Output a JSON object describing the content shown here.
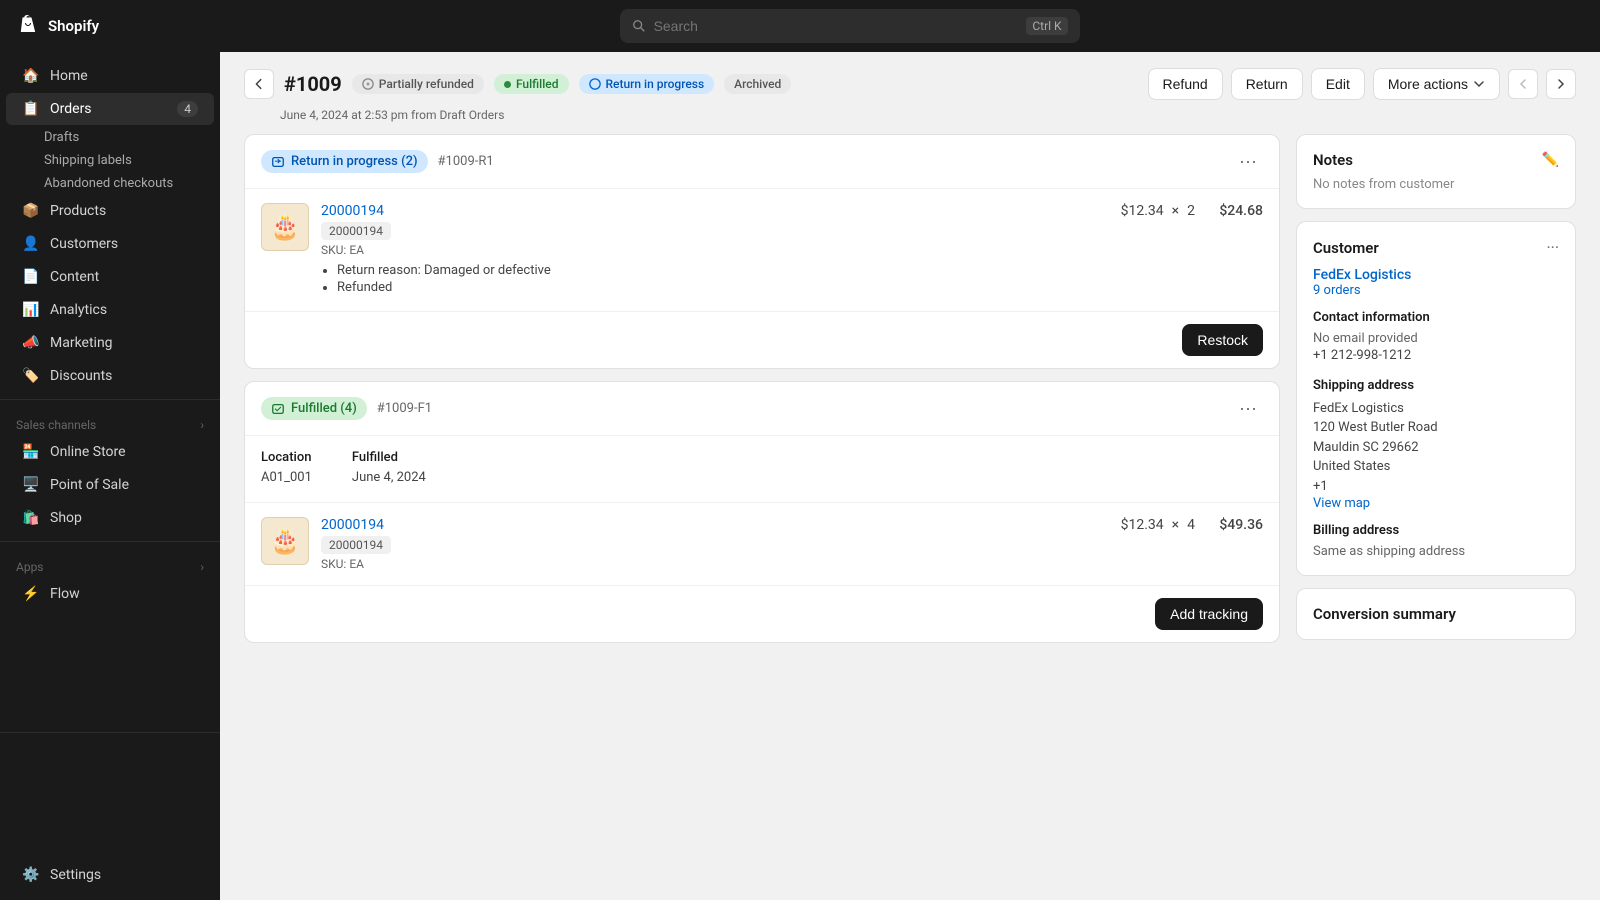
{
  "topbar": {
    "brand": "shopify",
    "search_placeholder": "Search",
    "search_shortcut": "Ctrl K"
  },
  "sidebar": {
    "home_label": "Home",
    "orders_label": "Orders",
    "orders_badge": "4",
    "drafts_label": "Drafts",
    "shipping_labels_label": "Shipping labels",
    "abandoned_checkouts_label": "Abandoned checkouts",
    "products_label": "Products",
    "customers_label": "Customers",
    "content_label": "Content",
    "analytics_label": "Analytics",
    "marketing_label": "Marketing",
    "discounts_label": "Discounts",
    "sales_channels_label": "Sales channels",
    "online_store_label": "Online Store",
    "pos_label": "Point of Sale",
    "shop_label": "Shop",
    "apps_label": "Apps",
    "flow_label": "Flow",
    "settings_label": "Settings"
  },
  "page": {
    "order_id": "#1009",
    "badge_partially_refunded": "Partially refunded",
    "badge_fulfilled": "Fulfilled",
    "badge_return_in_progress": "Return in progress",
    "badge_archived": "Archived",
    "subtitle": "June 4, 2024 at 2:53 pm from Draft Orders",
    "btn_refund": "Refund",
    "btn_return": "Return",
    "btn_edit": "Edit",
    "btn_more_actions": "More actions"
  },
  "return_section": {
    "badge": "Return in progress (2)",
    "id": "#1009-R1",
    "product_name": "20000194",
    "product_badge": "20000194",
    "sku": "SKU: EA",
    "price_unit": "$12.34",
    "qty": "2",
    "total": "$24.68",
    "bullet1": "Return reason: Damaged or defective",
    "bullet2": "Refunded",
    "btn_restock": "Restock"
  },
  "fulfilled_section": {
    "badge": "Fulfilled (4)",
    "id": "#1009-F1",
    "location_label": "Location",
    "location_value": "A01_001",
    "fulfilled_label": "Fulfilled",
    "fulfilled_date": "June 4, 2024",
    "product_name": "20000194",
    "product_badge": "20000194",
    "sku": "SKU: EA",
    "price_unit": "$12.34",
    "qty": "4",
    "total": "$49.36",
    "btn_add_tracking": "Add tracking"
  },
  "notes": {
    "title": "Notes",
    "text": "No notes from customer"
  },
  "customer": {
    "title": "Customer",
    "name": "FedEx Logistics",
    "orders": "9 orders",
    "contact_title": "Contact information",
    "email": "No email provided",
    "phone": "+1 212-998-1212",
    "shipping_title": "Shipping address",
    "shipping_name": "FedEx Logistics",
    "shipping_addr1": "120 West Butler Road",
    "shipping_addr2": "Mauldin SC 29662",
    "shipping_country": "United States",
    "shipping_plus": "+1",
    "view_map": "View map",
    "billing_title": "Billing address",
    "billing_same": "Same as shipping address"
  },
  "conversion": {
    "title": "Conversion summary"
  }
}
